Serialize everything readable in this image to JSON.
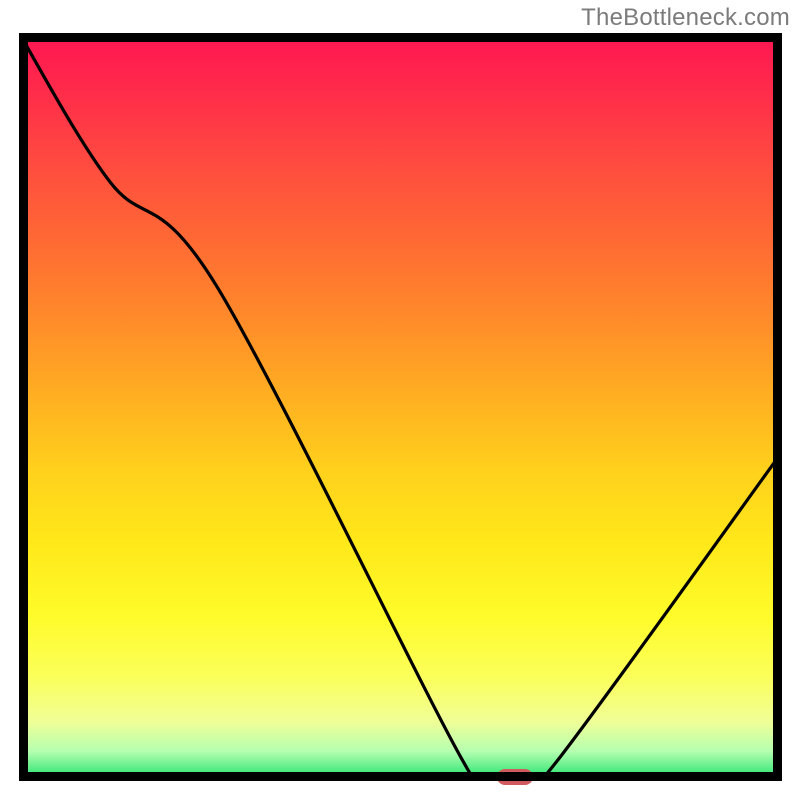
{
  "attribution": "TheBottleneck.com",
  "chart_data": {
    "type": "line",
    "title": "",
    "xlabel": "",
    "ylabel": "",
    "xlim": [
      0,
      100
    ],
    "ylim": [
      0,
      100
    ],
    "series": [
      {
        "name": "bottleneck-curve",
        "x": [
          0,
          12,
          26,
          58,
          62,
          66,
          70,
          100
        ],
        "y": [
          100,
          80,
          66,
          3,
          0.5,
          0.5,
          2,
          44
        ]
      }
    ],
    "optimal_marker": {
      "x": 65,
      "y": 0.5
    },
    "gradient_stops": [
      {
        "pos": 0,
        "color": "#ff1552"
      },
      {
        "pos": 50,
        "color": "#ffcf1c"
      },
      {
        "pos": 95,
        "color": "#f0ff96"
      },
      {
        "pos": 100,
        "color": "#1ed66b"
      }
    ]
  }
}
